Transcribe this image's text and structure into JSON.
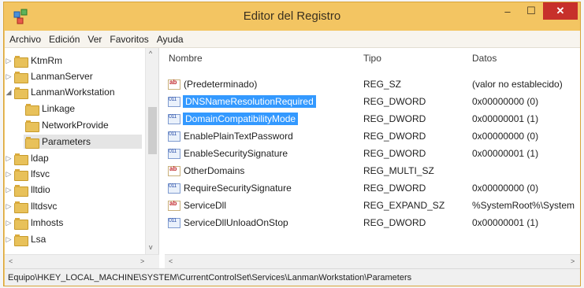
{
  "window": {
    "title": "Editor del Registro",
    "minimize": "–",
    "maximize": "☐",
    "close": "✕"
  },
  "menu": [
    "Archivo",
    "Edición",
    "Ver",
    "Favoritos",
    "Ayuda"
  ],
  "tree": {
    "items": [
      {
        "label": "KtmRm",
        "expander": "▷"
      },
      {
        "label": "LanmanServer",
        "expander": "▷"
      },
      {
        "label": "LanmanWorkstation",
        "expander": "◢"
      },
      {
        "label": "Linkage",
        "expander": ""
      },
      {
        "label": "NetworkProvide",
        "expander": ""
      },
      {
        "label": "Parameters",
        "expander": ""
      },
      {
        "label": "ldap",
        "expander": "▷"
      },
      {
        "label": "lfsvc",
        "expander": "▷"
      },
      {
        "label": "lltdio",
        "expander": "▷"
      },
      {
        "label": "lltdsvc",
        "expander": "▷"
      },
      {
        "label": "lmhosts",
        "expander": "▷"
      },
      {
        "label": "Lsa",
        "expander": "▷"
      }
    ]
  },
  "list": {
    "columns": {
      "name": "Nombre",
      "type": "Tipo",
      "data": "Datos"
    },
    "rows": [
      {
        "name": "(Predeterminado)",
        "type": "REG_SZ",
        "data": "(valor no establecido)",
        "icon": "string-value-icon"
      },
      {
        "name": "DNSNameResolutionRequired",
        "type": "REG_DWORD",
        "data": "0x00000000 (0)",
        "icon": "binary-value-icon"
      },
      {
        "name": "DomainCompatibilityMode",
        "type": "REG_DWORD",
        "data": "0x00000001 (1)",
        "icon": "binary-value-icon"
      },
      {
        "name": "EnablePlainTextPassword",
        "type": "REG_DWORD",
        "data": "0x00000000 (0)",
        "icon": "binary-value-icon"
      },
      {
        "name": "EnableSecuritySignature",
        "type": "REG_DWORD",
        "data": "0x00000001 (1)",
        "icon": "binary-value-icon"
      },
      {
        "name": "OtherDomains",
        "type": "REG_MULTI_SZ",
        "data": "",
        "icon": "string-value-icon"
      },
      {
        "name": "RequireSecuritySignature",
        "type": "REG_DWORD",
        "data": "0x00000000 (0)",
        "icon": "binary-value-icon"
      },
      {
        "name": "ServiceDll",
        "type": "REG_EXPAND_SZ",
        "data": "%SystemRoot%\\System",
        "icon": "string-value-icon"
      },
      {
        "name": "ServiceDllUnloadOnStop",
        "type": "REG_DWORD",
        "data": "0x00000001 (1)",
        "icon": "binary-value-icon"
      }
    ]
  },
  "status": "Equipo\\HKEY_LOCAL_MACHINE\\SYSTEM\\CurrentControlSet\\Services\\LanmanWorkstation\\Parameters"
}
